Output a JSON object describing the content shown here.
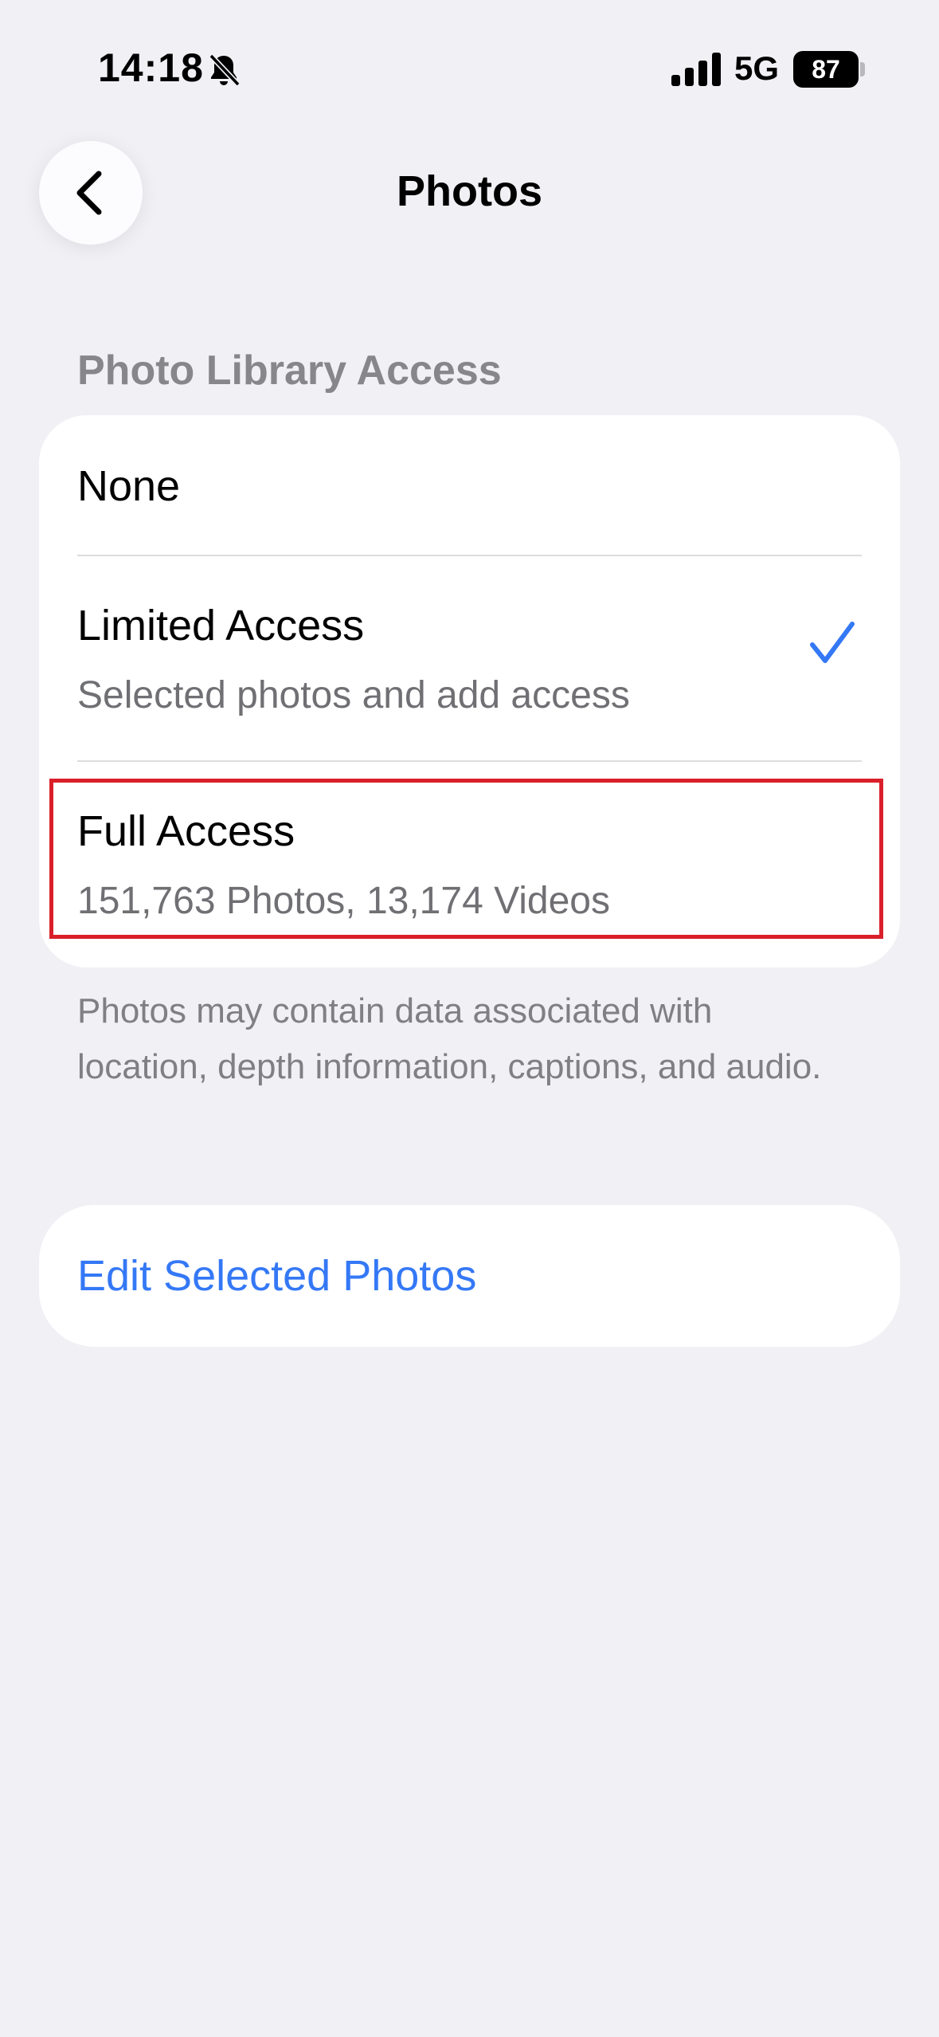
{
  "status_bar": {
    "time": "14:18",
    "network": "5G",
    "battery": "87",
    "icons": [
      "bell-slash-icon",
      "cellular-signal-icon",
      "battery-icon"
    ]
  },
  "nav": {
    "title": "Photos",
    "back_icon": "chevron-left-icon"
  },
  "section": {
    "header": "Photo Library Access",
    "options": [
      {
        "title": "None",
        "subtitle": "",
        "selected": false
      },
      {
        "title": "Limited Access",
        "subtitle": "Selected photos and add access",
        "selected": true
      },
      {
        "title": "Full Access",
        "subtitle": "151,763 Photos, 13,174 Videos",
        "selected": false
      }
    ],
    "footer": "Photos may contain data associated with location, depth information, captions, and audio."
  },
  "edit": {
    "label": "Edit Selected Photos"
  },
  "colors": {
    "background": "#f0f0f5",
    "accent": "#3478f6",
    "highlight": "#d9202a",
    "secondary_text": "#707074"
  }
}
